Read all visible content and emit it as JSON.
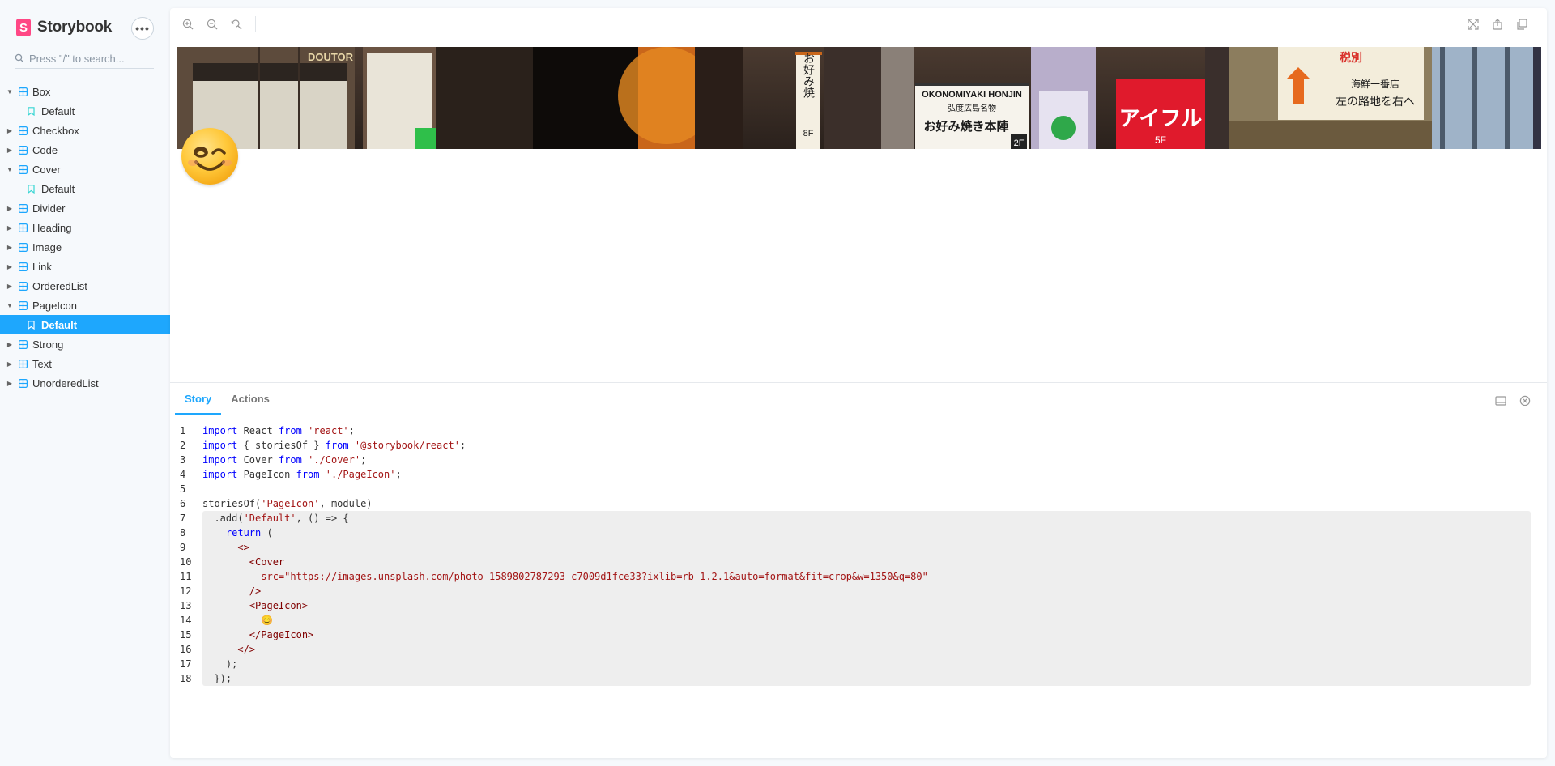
{
  "app": {
    "brand": "Storybook",
    "brand_logo_letter": "S",
    "brand_color": "#ff4785",
    "accent_color": "#1ea7fd",
    "menu_label": "•••"
  },
  "search": {
    "placeholder": "Press \"/\" to search..."
  },
  "tree": {
    "items": [
      {
        "label": "Box",
        "kind": "component",
        "expanded": true
      },
      {
        "label": "Default",
        "kind": "story",
        "selected": false
      },
      {
        "label": "Checkbox",
        "kind": "component",
        "expanded": false
      },
      {
        "label": "Code",
        "kind": "component",
        "expanded": false
      },
      {
        "label": "Cover",
        "kind": "component",
        "expanded": true
      },
      {
        "label": "Default",
        "kind": "story",
        "selected": false
      },
      {
        "label": "Divider",
        "kind": "component",
        "expanded": false
      },
      {
        "label": "Heading",
        "kind": "component",
        "expanded": false
      },
      {
        "label": "Image",
        "kind": "component",
        "expanded": false
      },
      {
        "label": "Link",
        "kind": "component",
        "expanded": false
      },
      {
        "label": "OrderedList",
        "kind": "component",
        "expanded": false
      },
      {
        "label": "PageIcon",
        "kind": "component",
        "expanded": true
      },
      {
        "label": "Default",
        "kind": "story",
        "selected": true
      },
      {
        "label": "Strong",
        "kind": "component",
        "expanded": false
      },
      {
        "label": "Text",
        "kind": "component",
        "expanded": false
      },
      {
        "label": "UnorderedList",
        "kind": "component",
        "expanded": false
      }
    ]
  },
  "toolbar": {
    "left": [
      "zoom-in-icon",
      "zoom-out-icon",
      "zoom-reset-icon"
    ],
    "right": [
      "fullscreen-icon",
      "share-icon",
      "copy-icon"
    ]
  },
  "preview": {
    "page_icon": "😊",
    "cover_signs": [
      "DOUTOR",
      "お好み焼",
      "8F",
      "OKONOMIYAKI HONJIN",
      "弘度広島名物",
      "お好み焼き本陣",
      "2F",
      "アイフル",
      "5F",
      "税別",
      "左の路地を右へ",
      "海鮮一番店"
    ]
  },
  "panel": {
    "tabs": [
      {
        "label": "Story",
        "active": true
      },
      {
        "label": "Actions",
        "active": false
      }
    ]
  },
  "code": {
    "lines": [
      [
        [
          "kw",
          "import"
        ],
        [
          "p",
          " React "
        ],
        [
          "kw",
          "from"
        ],
        [
          "p",
          " "
        ],
        [
          "str",
          "'react'"
        ],
        [
          "p",
          ";"
        ]
      ],
      [
        [
          "kw",
          "import"
        ],
        [
          "p",
          " { storiesOf } "
        ],
        [
          "kw",
          "from"
        ],
        [
          "p",
          " "
        ],
        [
          "str",
          "'@storybook/react'"
        ],
        [
          "p",
          ";"
        ]
      ],
      [
        [
          "kw",
          "import"
        ],
        [
          "p",
          " Cover "
        ],
        [
          "kw",
          "from"
        ],
        [
          "p",
          " "
        ],
        [
          "str",
          "'./Cover'"
        ],
        [
          "p",
          ";"
        ]
      ],
      [
        [
          "kw",
          "import"
        ],
        [
          "p",
          " PageIcon "
        ],
        [
          "kw",
          "from"
        ],
        [
          "p",
          " "
        ],
        [
          "str",
          "'./PageIcon'"
        ],
        [
          "p",
          ";"
        ]
      ],
      [
        [
          "p",
          ""
        ]
      ],
      [
        [
          "p",
          "storiesOf("
        ],
        [
          "str",
          "'PageIcon'"
        ],
        [
          "p",
          ", module)"
        ]
      ],
      [
        [
          "p",
          "  .add("
        ],
        [
          "str",
          "'Default'"
        ],
        [
          "p",
          ", () => {"
        ]
      ],
      [
        [
          "p",
          "    "
        ],
        [
          "kw",
          "return"
        ],
        [
          "p",
          " ("
        ]
      ],
      [
        [
          "p",
          "      "
        ],
        [
          "tag",
          "<>"
        ]
      ],
      [
        [
          "p",
          "        "
        ],
        [
          "tag",
          "<Cover"
        ]
      ],
      [
        [
          "p",
          "          "
        ],
        [
          "attr",
          "src=\"https://images.unsplash.com/photo-1589802787293-c7009d1fce33?ixlib=rb-1.2.1&auto=format&fit=crop&w=1350&q=80\""
        ]
      ],
      [
        [
          "p",
          "        "
        ],
        [
          "tag",
          "/>"
        ]
      ],
      [
        [
          "p",
          "        "
        ],
        [
          "tag",
          "<PageIcon>"
        ]
      ],
      [
        [
          "p",
          "          😊"
        ]
      ],
      [
        [
          "p",
          "        "
        ],
        [
          "tag",
          "</PageIcon>"
        ]
      ],
      [
        [
          "p",
          "      "
        ],
        [
          "tag",
          "</>"
        ]
      ],
      [
        [
          "p",
          "    );"
        ]
      ],
      [
        [
          "p",
          "  });"
        ]
      ]
    ]
  }
}
